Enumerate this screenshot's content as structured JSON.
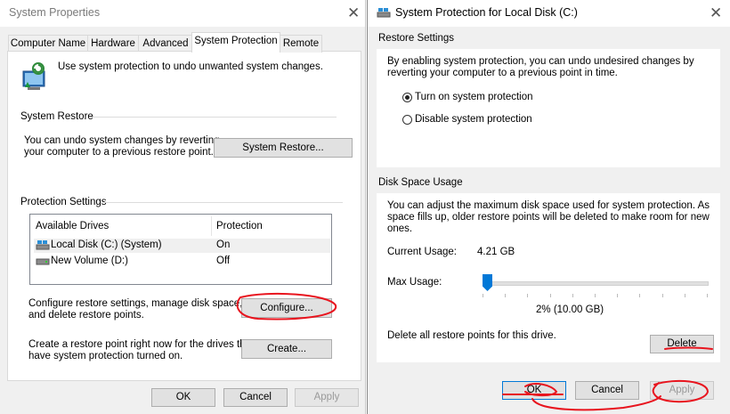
{
  "left_window": {
    "title": "System Properties",
    "tabs": [
      {
        "label": "Computer Name"
      },
      {
        "label": "Hardware"
      },
      {
        "label": "Advanced"
      },
      {
        "label": "System Protection"
      },
      {
        "label": "Remote"
      }
    ],
    "intro_text": "Use system protection to undo unwanted system changes.",
    "system_restore": {
      "title": "System Restore",
      "description_line1": "You can undo system changes by reverting",
      "description_line2": "your computer to a previous restore point.",
      "button_label": "System Restore..."
    },
    "protection_settings": {
      "title": "Protection Settings",
      "columns": [
        "Available Drives",
        "Protection"
      ],
      "drives": [
        {
          "name": "Local Disk (C:) (System)",
          "protection": "On"
        },
        {
          "name": "New Volume (D:)",
          "protection": "Off"
        }
      ],
      "configure_text_line1": "Configure restore settings, manage disk space,",
      "configure_text_line2": "and delete restore points.",
      "configure_label": "Configure...",
      "create_text_line1": "Create a restore point right now for the drives that",
      "create_text_line2": "have system protection turned on.",
      "create_label": "Create..."
    },
    "buttons": {
      "ok": "OK",
      "cancel": "Cancel",
      "apply": "Apply"
    }
  },
  "right_window": {
    "title": "System Protection for Local Disk (C:)",
    "restore_settings": {
      "title": "Restore Settings",
      "description_line1": "By enabling system protection, you can undo undesired changes by",
      "description_line2": "reverting your computer to a previous point in time.",
      "options": [
        {
          "label": "Turn on system protection",
          "selected": true
        },
        {
          "label": "Disable system protection",
          "selected": false
        }
      ]
    },
    "disk_space": {
      "title": "Disk Space Usage",
      "description_line1": "You can adjust the maximum disk space used for system protection. As",
      "description_line2": "space fills up, older restore points will be deleted to make room for new",
      "description_line3": "ones.",
      "current_usage_label": "Current Usage:",
      "current_usage_value": "4.21 GB",
      "max_usage_label": "Max Usage:",
      "max_usage_fraction": 0.02,
      "max_usage_value": "2% (10.00 GB)",
      "delete_text": "Delete all restore points for this drive.",
      "delete_label": "Delete"
    },
    "buttons": {
      "ok": "OK",
      "cancel": "Cancel",
      "apply": "Apply"
    }
  },
  "colors": {
    "accent": "#0078d7",
    "annotation": "#e8141e",
    "window_bg": "#f0f0f0"
  },
  "icons": [
    "system-protection-icon",
    "close-icon",
    "drive-icon",
    "system-drive-icon",
    "dialog-drive-icon"
  ]
}
